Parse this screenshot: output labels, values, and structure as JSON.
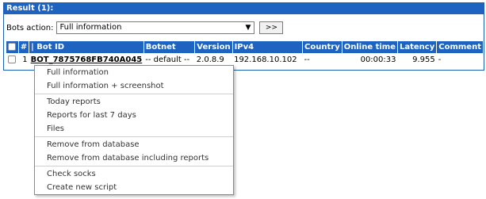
{
  "panel": {
    "title": "Result (1):"
  },
  "actions": {
    "label": "Bots action:",
    "selected": "Full information",
    "go_label": ">>"
  },
  "table": {
    "headers": [
      "#",
      "| Bot ID",
      "Botnet",
      "Version",
      "IPv4",
      "Country",
      "Online time",
      "Latency",
      "Comment"
    ],
    "rows": [
      {
        "index": "1",
        "bot_id": "BOT_7875768FB740A045",
        "botnet": "-- default --",
        "version": "2.0.8.9",
        "ipv4": "192.168.10.102",
        "country": "--",
        "online_time": "00:00:33",
        "latency": "9.955",
        "comment": "-"
      }
    ]
  },
  "context_menu": {
    "groups": [
      [
        "Full information",
        "Full information + screenshot"
      ],
      [
        "Today reports",
        "Reports for last 7 days",
        "Files"
      ],
      [
        "Remove from database",
        "Remove from database including reports"
      ],
      [
        "Check socks",
        "Create new script"
      ]
    ]
  }
}
